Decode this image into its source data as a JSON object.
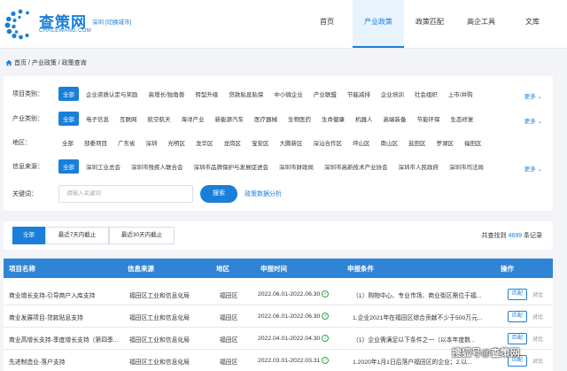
{
  "header": {
    "brand_name": "查策网",
    "brand_sub": "CHACEWANG.COM",
    "city": "深圳 [切换城市]",
    "nav": [
      "首页",
      "产业政策",
      "政策匹配",
      "高企工具",
      "文库"
    ],
    "active_nav": "产业政策"
  },
  "breadcrumb": "首页 / 产业政策 / 政策查询",
  "filters": {
    "project_type": {
      "label": "项目类别：",
      "options": [
        "全部",
        "企业资质认定与奖励",
        "高增长/独角兽",
        "转型升级",
        "贷款贴息贴保",
        "中小微企业",
        "产业联盟",
        "节能减排",
        "企业培训",
        "社会组织",
        "上市/并购"
      ]
    },
    "industry": {
      "label": "产业类别：",
      "options": [
        "全部",
        "电子信息",
        "互联网",
        "航空航天",
        "海洋产业",
        "新能源汽车",
        "医疗器械",
        "生物医药",
        "生命健康",
        "机器人",
        "高端装备",
        "节能环保",
        "生态修复"
      ]
    },
    "region": {
      "label": "地区：",
      "options": [
        "全部",
        "部委项目",
        "广东省",
        "深圳",
        "光明区",
        "龙华区",
        "龙岗区",
        "宝安区",
        "大鹏新区",
        "深汕合作区",
        "坪山区",
        "南山区",
        "盐田区",
        "罗湖区",
        "福田区"
      ]
    },
    "source": {
      "label": "信息来源：",
      "options": [
        "全部",
        "深圳工业总会",
        "深圳市残疾人联合会",
        "深圳市品牌保护与发展促进会",
        "深圳市财政局",
        "深圳市高新技术产业协会",
        "深圳市人民政府",
        "深圳市司法局"
      ]
    },
    "more_label": "更多 ⌄",
    "keyword": {
      "label": "关键词：",
      "placeholder": "请输入关键词",
      "search_button": "搜索",
      "analysis_link": "政策数据分析"
    }
  },
  "time_filter": {
    "tabs": [
      "全部",
      "最近7天内截止",
      "最近30天内截止"
    ],
    "found_prefix": "共查找到",
    "found_count": "4699",
    "found_suffix": "条记录"
  },
  "table": {
    "headers": [
      "项目名称",
      "信息来源",
      "地区",
      "申报时间",
      "申报条件",
      "操作"
    ],
    "rows": [
      {
        "name": "商业增长支持-引导商户入库支持",
        "source": "福田区工业和信息化局",
        "region": "福田区",
        "time": "2022.06.01-2022.06.30",
        "condition": "（1）购物中心、专业市场、商业街区需位于福...",
        "match": "匹配",
        "compare": "对比"
      },
      {
        "name": "商业发展项目-贷款贴息支持",
        "source": "福田区工业和信息化局",
        "region": "福田区",
        "time": "2022.06.01-2022.06.30",
        "condition": "1.企业2021年在福田区综合贡献不少于500万元...",
        "match": "匹配",
        "compare": "对比"
      },
      {
        "name": "商业高增长支持-季度增长支持（第四季...",
        "source": "福田区工业和信息化局",
        "region": "福田区",
        "time": "2022.04.01-2022.04.30",
        "condition": "（1）企业需满足以下条件之一（以本年度数...",
        "match": "匹配",
        "compare": "对比"
      },
      {
        "name": "先进制造业-落户支持",
        "source": "福田区工业和信息化局",
        "region": "福田区",
        "time": "2022.03.01-2022.03.31",
        "condition": "1.2020年1月1日后落户福田区的企业；2.以...",
        "match": "匹配",
        "compare": "对比"
      }
    ]
  },
  "watermark": "搜狐号@查策网",
  "colors": {
    "accent": "#1a7fd8",
    "table_header": "#2f84d6",
    "ok_green": "#2ba84a"
  }
}
